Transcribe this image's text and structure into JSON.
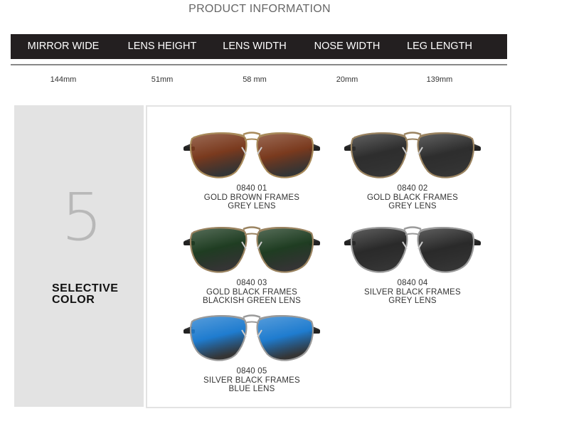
{
  "section_title": "PRODUCT INFORMATION",
  "specs": {
    "headers": [
      "MIRROR WIDE",
      "LENS HEIGHT",
      "LENS WIDTH",
      "NOSE WIDTH",
      "LEG LENGTH"
    ],
    "values": [
      "144mm",
      "51mm",
      "58 mm",
      "20mm",
      "139mm"
    ]
  },
  "selection": {
    "count": "5",
    "label_line1": "SELECTIVE",
    "label_line2": "COLOR"
  },
  "products": [
    {
      "code": "0840  01",
      "frame": "GOLD BROWN FRAMES",
      "lens": "GREY LENS",
      "lens_color": "#7a3a1e",
      "frame_color": "#a88a5a"
    },
    {
      "code": "0840 02",
      "frame": "GOLD BLACK FRAMES",
      "lens": "GREY LENS",
      "lens_color": "#2e2e2e",
      "frame_color": "#9a8360"
    },
    {
      "code": "0840 03",
      "frame": "GOLD BLACK FRAMES",
      "lens": "BLACKISH GREEN LENS",
      "lens_color": "#1f3d22",
      "frame_color": "#9a8360"
    },
    {
      "code": "0840  04",
      "frame": "SILVER BLACK FRAMES",
      "lens": "GREY LENS",
      "lens_color": "#2a2a2a",
      "frame_color": "#9a9a9a"
    },
    {
      "code": "0840  05",
      "frame": "SILVER BLACK FRAMES",
      "lens": "BLUE LENS",
      "lens_color": "#1f7ccf",
      "frame_color": "#9a9a9a"
    }
  ]
}
